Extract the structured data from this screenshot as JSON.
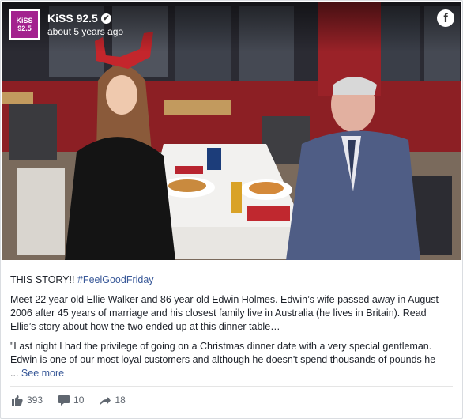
{
  "header": {
    "logo_text_line1": "KiSS",
    "logo_text_line2": "92.5",
    "page_name": "KiSS 92.5",
    "verified_mark": "✔",
    "timestamp": "about 5 years ago",
    "facebook_icon": "f"
  },
  "photo": {
    "description_icon": "photo"
  },
  "post": {
    "headline": "THIS STORY!! ",
    "hashtag": "#FeelGoodFriday",
    "paragraph1": "Meet 22 year old Ellie Walker and 86 year old Edwin Holmes. Edwin’s wife passed away in August 2006 after 45 years of marriage and his closest family live in Australia (he lives in Britain). Read Ellie’s story about how the two ended up at this dinner table…",
    "paragraph2": "\"Last night I had the privilege of going on a Christmas dinner date with a very special gentleman. Edwin is one of our most loyal customers and although he doesn't spend thousands of pounds he",
    "ellipsis": "... ",
    "see_more": "See more"
  },
  "actions": {
    "likes": "393",
    "comments": "10",
    "shares": "18"
  }
}
